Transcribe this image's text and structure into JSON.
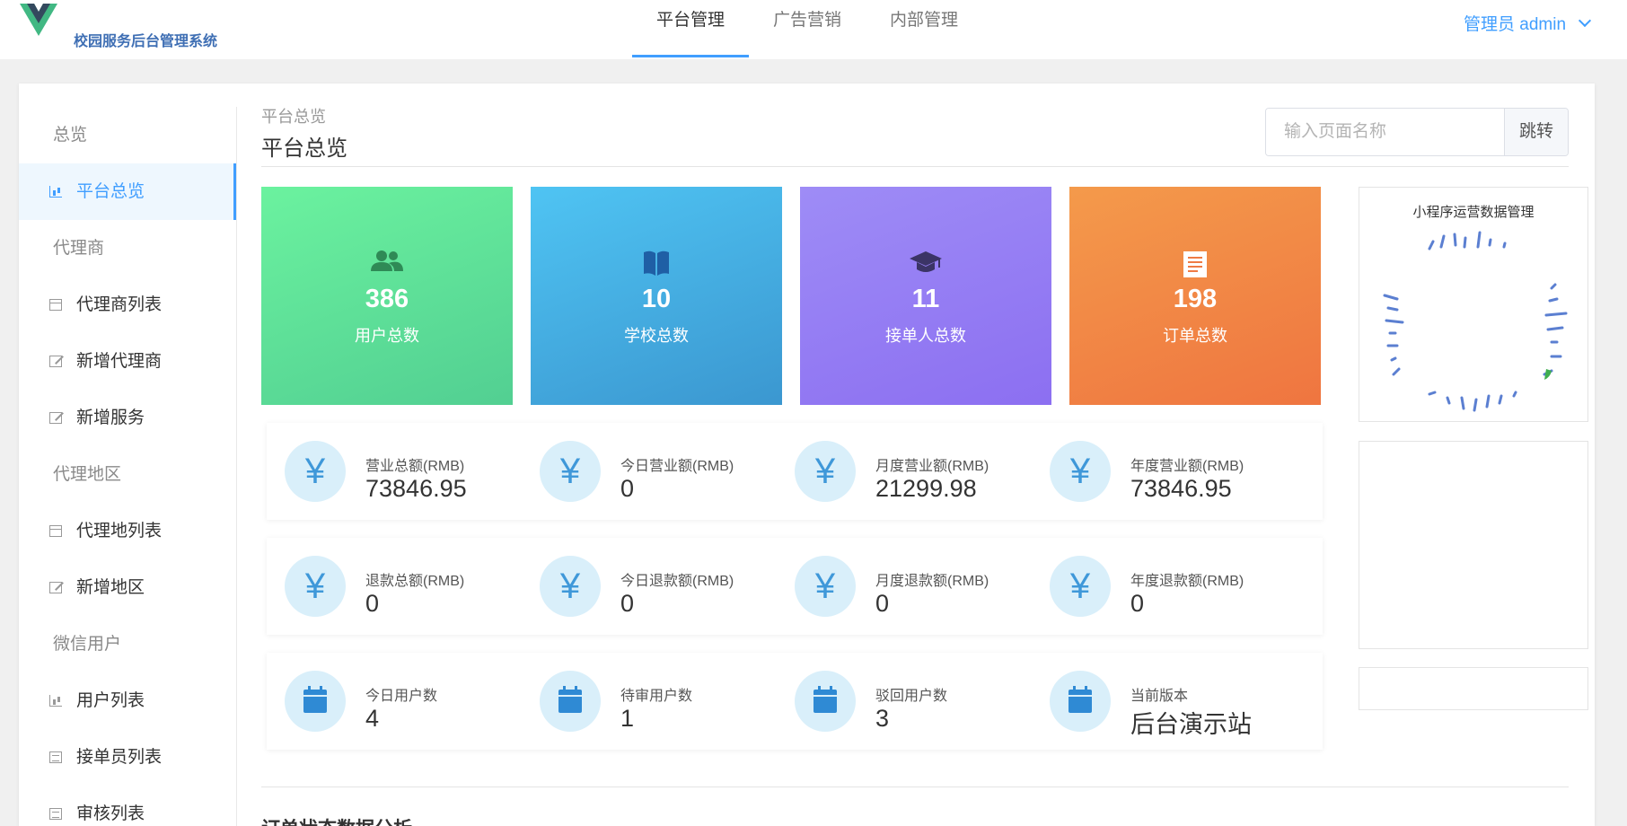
{
  "header": {
    "system_title": "校园服务后台管理系统",
    "tabs": [
      {
        "label": "平台管理",
        "active": true
      },
      {
        "label": "广告营销",
        "active": false
      },
      {
        "label": "内部管理",
        "active": false
      }
    ],
    "user_label": "管理员 admin"
  },
  "sidebar": {
    "groups": [
      {
        "title": "总览",
        "items": [
          {
            "label": "平台总览",
            "icon": "chart-icon",
            "active": true
          }
        ]
      },
      {
        "title": "代理商",
        "items": [
          {
            "label": "代理商列表",
            "icon": "calendar-icon"
          },
          {
            "label": "新增代理商",
            "icon": "edit-icon"
          },
          {
            "label": "新增服务",
            "icon": "edit-icon"
          }
        ]
      },
      {
        "title": "代理地区",
        "items": [
          {
            "label": "代理地列表",
            "icon": "calendar-icon"
          },
          {
            "label": "新增地区",
            "icon": "edit-icon"
          }
        ]
      },
      {
        "title": "微信用户",
        "items": [
          {
            "label": "用户列表",
            "icon": "chart-icon"
          },
          {
            "label": "接单员列表",
            "icon": "list-icon"
          },
          {
            "label": "审核列表",
            "icon": "list-icon"
          }
        ]
      }
    ]
  },
  "main": {
    "breadcrumb": "平台总览",
    "page_title": "平台总览",
    "search": {
      "placeholder": "输入页面名称",
      "button_label": "跳转"
    },
    "stat_cards": [
      {
        "value": "386",
        "label": "用户总数",
        "icon": "users-icon",
        "color": "#5bdc96"
      },
      {
        "value": "10",
        "label": "学校总数",
        "icon": "book-icon",
        "color": "#45aee2"
      },
      {
        "value": "11",
        "label": "接单人总数",
        "icon": "graduation-cap-icon",
        "color": "#957df4"
      },
      {
        "value": "198",
        "label": "订单总数",
        "icon": "document-icon",
        "color": "#f18846"
      }
    ],
    "revenue_row": [
      {
        "label": "营业总额(RMB)",
        "value": "73846.95"
      },
      {
        "label": "今日营业额(RMB)",
        "value": "0"
      },
      {
        "label": "月度营业额(RMB)",
        "value": "21299.98"
      },
      {
        "label": "年度营业额(RMB)",
        "value": "73846.95"
      }
    ],
    "refund_row": [
      {
        "label": "退款总额(RMB)",
        "value": "0"
      },
      {
        "label": "今日退款额(RMB)",
        "value": "0"
      },
      {
        "label": "月度退款额(RMB)",
        "value": "0"
      },
      {
        "label": "年度退款额(RMB)",
        "value": "0"
      }
    ],
    "user_row": [
      {
        "label": "今日用户数",
        "value": "4"
      },
      {
        "label": "待审用户数",
        "value": "1"
      },
      {
        "label": "驳回用户数",
        "value": "3"
      },
      {
        "label": "当前版本",
        "value": "后台演示站"
      }
    ],
    "yuan_symbol": "¥",
    "side_panel_title": "小程序运营数据管理",
    "bottom_section_title": "订单状态数据分析"
  },
  "colors": {
    "accent": "#409eff",
    "metric_icon": "#3f98d9",
    "metric_circle": "#d9effa"
  }
}
